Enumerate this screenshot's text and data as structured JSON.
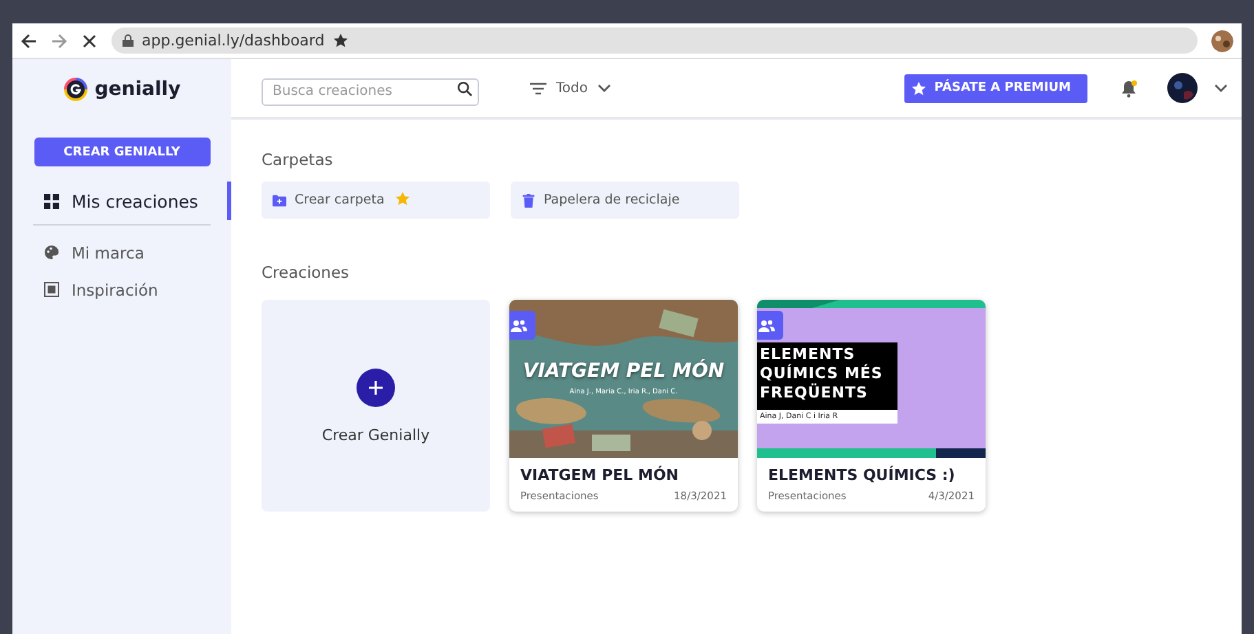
{
  "browser": {
    "url": "app.genial.ly/dashboard"
  },
  "sidebar": {
    "logo": "genially",
    "create_button": "CREAR GENIALLY",
    "items": [
      {
        "label": "Mis creaciones",
        "selected": true
      },
      {
        "label": "Mi marca",
        "selected": false
      },
      {
        "label": "Inspiración",
        "selected": false
      }
    ]
  },
  "header": {
    "search": {
      "placeholder": "Busca creaciones"
    },
    "filter": "Todo",
    "premium_button": "PÁSATE A PREMIUM",
    "notification_dot": true
  },
  "folders": {
    "title": "Carpetas",
    "items": [
      {
        "label": "Crear carpeta",
        "starred": true
      },
      {
        "label": "Papelera de reciclaje",
        "starred": false
      }
    ]
  },
  "creations": {
    "title": "Creaciones",
    "create_label": "Crear Genially",
    "items": [
      {
        "title": "VIATGEM PEL MÓN",
        "type": "Presentaciones",
        "date": "18/3/2021",
        "thumb": {
          "heading": "VIATGEM PEL MÓN",
          "credits": "Aina J., Maria C., Iria R., Dani C."
        }
      },
      {
        "title": "ELEMENTS QUÍMICS :)",
        "type": "Presentaciones",
        "date": "4/3/2021",
        "thumb": {
          "kind": "slide",
          "heading": "ELEMENTS QUÍMICS MÉS FREQÜENTS",
          "credits": "Aina J, Dani C i Iria R"
        }
      }
    ]
  }
}
